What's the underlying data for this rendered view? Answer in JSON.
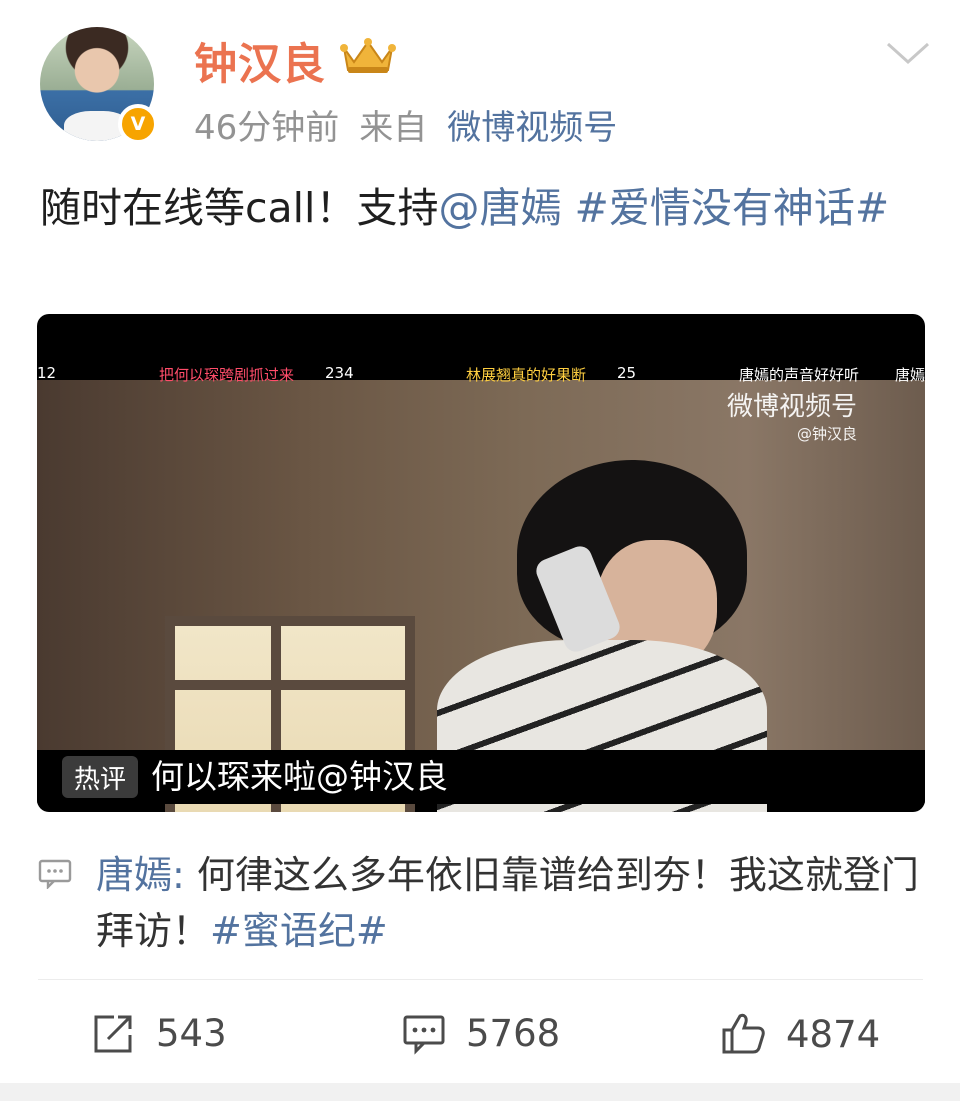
{
  "post": {
    "username": "钟汉良",
    "time": "46分钟前",
    "source_prefix": "来自",
    "source": "微博视频号",
    "text_prefix": "随时在线等call！支持",
    "mention": "@唐嫣",
    "hashtag": "#爱情没有神话#"
  },
  "video": {
    "danmu": [
      {
        "text": "12",
        "color": "#ffffff"
      },
      {
        "text": "把何以琛跨剧抓过来",
        "color": "#ff4d6a"
      },
      {
        "text": "234",
        "color": "#ffffff"
      },
      {
        "text": "林展翘真的好果断",
        "color": "#ffcf40"
      },
      {
        "text": "25",
        "color": "#ffffff"
      },
      {
        "text": "唐嫣的声音好好听",
        "color": "#ffffff"
      },
      {
        "text": "唐嫣",
        "color": "#ffffff"
      }
    ],
    "watermark": "微博视频号",
    "watermark_sub": "@钟汉良",
    "hot_tag": "热评",
    "hot_comment": "何以琛来啦@钟汉良"
  },
  "repost": {
    "author": "唐嫣",
    "colon": ":",
    "text": "何律这么多年依旧靠谱给到夯！我这就登门拜访！",
    "hashtag": "#蜜语纪#"
  },
  "actions": {
    "share_count": "543",
    "comment_count": "5768",
    "like_count": "4874"
  },
  "colors": {
    "username": "#eb7350",
    "link": "#53739f",
    "meta": "#939393"
  },
  "icons": [
    "verified-badge-icon",
    "crown-badge-icon",
    "chevron-down-icon",
    "share-icon",
    "comment-icon",
    "like-icon",
    "repost-comment-icon"
  ]
}
